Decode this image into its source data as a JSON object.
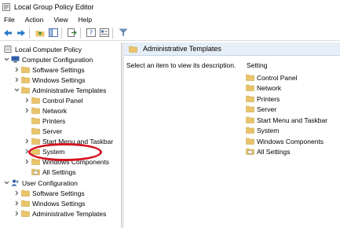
{
  "window": {
    "title": "Local Group Policy Editor"
  },
  "menu": [
    "File",
    "Action",
    "View",
    "Help"
  ],
  "toolbar": [
    "back-icon",
    "forward-icon",
    "up-folder-icon",
    "show-hide-tree-icon",
    "export-icon",
    "help-icon",
    "properties-icon",
    "filter-icon"
  ],
  "tree": {
    "root": "Local Computer Policy",
    "computer_config": "Computer Configuration",
    "software_settings": "Software Settings",
    "windows_settings": "Windows Settings",
    "admin_templates": "Administrative Templates",
    "children": [
      "Control Panel",
      "Network",
      "Printers",
      "Server",
      "Start Menu and Taskbar",
      "System",
      "Windows Components",
      "All Settings"
    ],
    "user_config": "User Configuration",
    "user_children": [
      "Software Settings",
      "Windows Settings",
      "Administrative Templates"
    ]
  },
  "right": {
    "header": "Administrative Templates",
    "description": "Select an item to view its description.",
    "column": "Setting",
    "items": [
      "Control Panel",
      "Network",
      "Printers",
      "Server",
      "Start Menu and Taskbar",
      "System",
      "Windows Components",
      "All Settings"
    ]
  },
  "colors": {
    "folder": "#e9c46a",
    "annotation": "#d41421",
    "header_bg": "#e6eef7"
  }
}
